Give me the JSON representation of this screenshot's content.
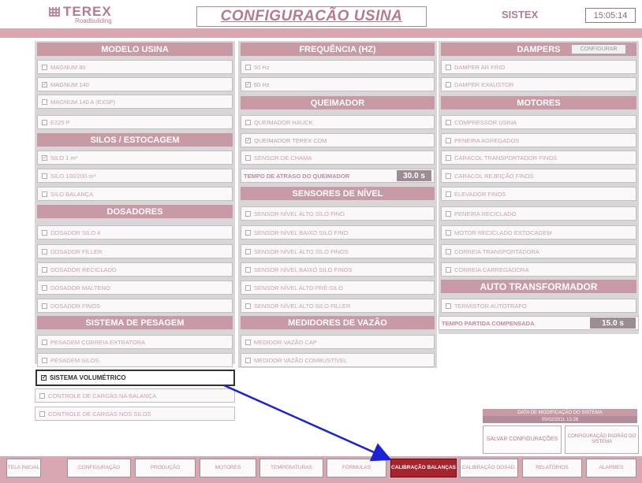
{
  "header": {
    "logo_name": "TEREX",
    "logo_sub": "Roadbuilding",
    "title": "CONFIGURACÃO USINA",
    "brand": "SISTEX",
    "clock": "15:05:14"
  },
  "col1": {
    "modelo_title": "MODELO USINA",
    "modelo": [
      "MAGNUM 80",
      "MAGNUM 140",
      "MAGNUM 140 A (EXSP)",
      "E225 P"
    ],
    "silos_title": "SILOS / ESTOCAGEM",
    "silos": [
      "SILO 1 m³",
      "SILO 100/200 m³",
      "SILO BALANÇA"
    ],
    "dosadores_title": "DOSADORES",
    "dosadores": [
      "DOSADOR SILO 4",
      "DOSADOR FILLER",
      "DOSADOR RECICLADO",
      "DOSADOR MALTENO",
      "DOSADOR FINOS"
    ],
    "pesagem_title": "SISTEMA DE PESAGEM",
    "pesagem": [
      "PESAGEM CORREIA EXTRATORA",
      "PESAGEM SILOS"
    ],
    "volumetrico": "SISTEMA VOLUMÉTRICO",
    "pesagem_extra": [
      "CONTROLE DE CARGAS NA BALANÇA",
      "CONTROLE DE CARGAS NOS SILOS"
    ]
  },
  "col2": {
    "freq_title": "FREQUÊNCIA (HZ)",
    "freq": [
      "50 Hz",
      "60 Hz"
    ],
    "queimador_title": "QUEIMADOR",
    "queimador": [
      "QUEIMADOR HAUCK",
      "QUEIMADOR TEREX CDM",
      "SENSOR DE CHAMA"
    ],
    "atraso_label": "TEMPO DE ATRASO DO QUEIMADOR",
    "atraso_value": "30.0 s",
    "sensores_title": "SENSORES DE NÍVEL",
    "sensores": [
      "SENSOR NÍVEL ALTO SILO FINO",
      "SENSOR NÍVEL BAIXO SILO FINO",
      "SENSOR NÍVEL ALTO SILO FINOS",
      "SENSOR NÍVEL BAIXO SILO FINOS",
      "SENSOR NÍVEL ALTO PRÉ-SILO",
      "SENSOR NÍVEL ALTO SILO FILLER"
    ],
    "vazao_title": "MEDIDORES DE VAZÃO",
    "vazao": [
      "MEDIDOR VAZÃO CAP",
      "MEDIDOR VAZÃO COMBUSTÍVEL"
    ]
  },
  "col3": {
    "dampers_title": "DAMPERS",
    "dampers_btn": "CONFIGURAR",
    "dampers": [
      "DAMPER AR FRIO",
      "DAMPER EXAUSTOR"
    ],
    "motores_title": "MOTORES",
    "motores": [
      "COMPRESSOR USINA",
      "PENEIRA AGREGADOS",
      "CARACOL TRANSPORTADOR FINOS",
      "CARACOL REJEIÇÃO FINOS",
      "ELEVADOR FINOS",
      "PENEIRA RECICLADO",
      "MOTOR RECICLADO ESTOCAGEM",
      "CORREIA TRANSPORTADORA",
      "CORREIA CARREGADORA"
    ],
    "auto_title": "AUTO TRANSFORMADOR",
    "auto": [
      "TERMISTOR AUTOTRAFO"
    ],
    "partida_label": "TEMPO PARTIDA COMPENSADA",
    "partida_value": "15.0 s"
  },
  "save": {
    "hdr": "DATA DE MODIFICAÇÃO DO SISTEMA",
    "val": "05/02/2011 13:28",
    "btn1": "SALVAR CONFIGURAÇÕES",
    "btn2": "CONFIGURAÇÃO PADRÃO DO SISTEMA"
  },
  "nav": [
    "TELA INICIAL",
    "CONFIGURAÇÃO",
    "PRODUÇÃO",
    "MOTORES",
    "TEMPERATURAS",
    "FÓRMULAS",
    "CALIBRAÇÃO BALANÇAS",
    "CALIBRAÇÃO DOSAD.",
    "RELATÓRIOS",
    "ALARMES"
  ],
  "colors": {
    "accent": "#c79aa5",
    "band": "#d9a7b2",
    "active_tab": "#a9232d",
    "arrow": "#1a22d8"
  }
}
